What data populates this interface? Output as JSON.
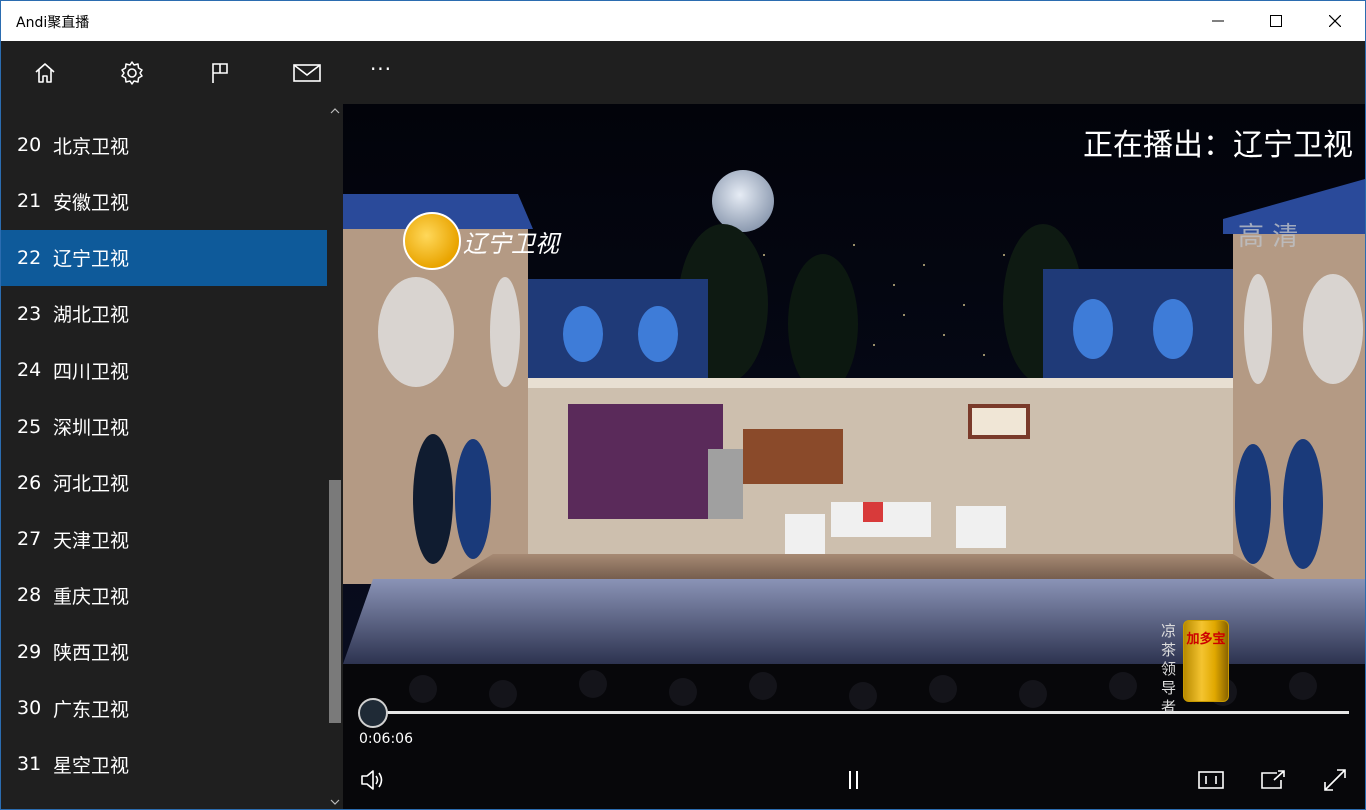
{
  "window": {
    "title": "Andi聚直播"
  },
  "toolbar": {
    "icons": [
      "home-icon",
      "settings-icon",
      "flag-icon",
      "mail-icon"
    ],
    "more_label": "···"
  },
  "channels": [
    {
      "num": "20",
      "name": "北京卫视",
      "selected": false
    },
    {
      "num": "21",
      "name": "安徽卫视",
      "selected": false
    },
    {
      "num": "22",
      "name": "辽宁卫视",
      "selected": true
    },
    {
      "num": "23",
      "name": "湖北卫视",
      "selected": false
    },
    {
      "num": "24",
      "name": "四川卫视",
      "selected": false
    },
    {
      "num": "25",
      "name": "深圳卫视",
      "selected": false
    },
    {
      "num": "26",
      "name": "河北卫视",
      "selected": false
    },
    {
      "num": "27",
      "name": "天津卫视",
      "selected": false
    },
    {
      "num": "28",
      "name": "重庆卫视",
      "selected": false
    },
    {
      "num": "29",
      "name": "陕西卫视",
      "selected": false
    },
    {
      "num": "30",
      "name": "广东卫视",
      "selected": false
    },
    {
      "num": "31",
      "name": "星空卫视",
      "selected": false
    }
  ],
  "player": {
    "now_playing": "正在播出：辽宁卫视",
    "station_logo_text": "辽宁卫视",
    "hd_label": "高 清",
    "sponsor_text": "凉茶领导者",
    "sponsor_can_text": "加多宝",
    "time": "0:06:06",
    "progress": 0.0
  },
  "colors": {
    "accent": "#0e5a9a",
    "background": "#1f1f1f",
    "titlebar": "#ffffff"
  }
}
